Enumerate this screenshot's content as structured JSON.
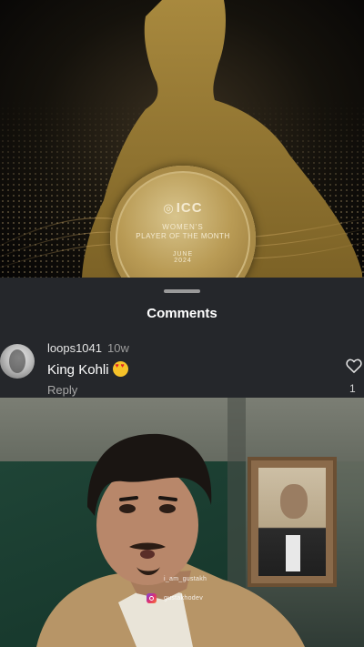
{
  "poster": {
    "brand": "ICC",
    "award_line1": "WOMEN'S",
    "award_line2": "PLAYER OF THE MONTH",
    "month": "JUNE",
    "year": "2024"
  },
  "comments_sheet": {
    "title": "Comments",
    "comment": {
      "username": "loops1041",
      "time": "10w",
      "text": "King Kohli",
      "emoji": "heart-eyes-emoji",
      "reply_label": "Reply",
      "like_count": "1"
    }
  },
  "video": {
    "watermark_user": "i_am_gustakh",
    "watermark_instagram": "gustakhodev"
  },
  "icons": {
    "like": "heart-outline-icon",
    "instagram": "instagram-icon"
  },
  "colors": {
    "sheet_background": "#25272b",
    "medal_gold": "#b99b55"
  }
}
